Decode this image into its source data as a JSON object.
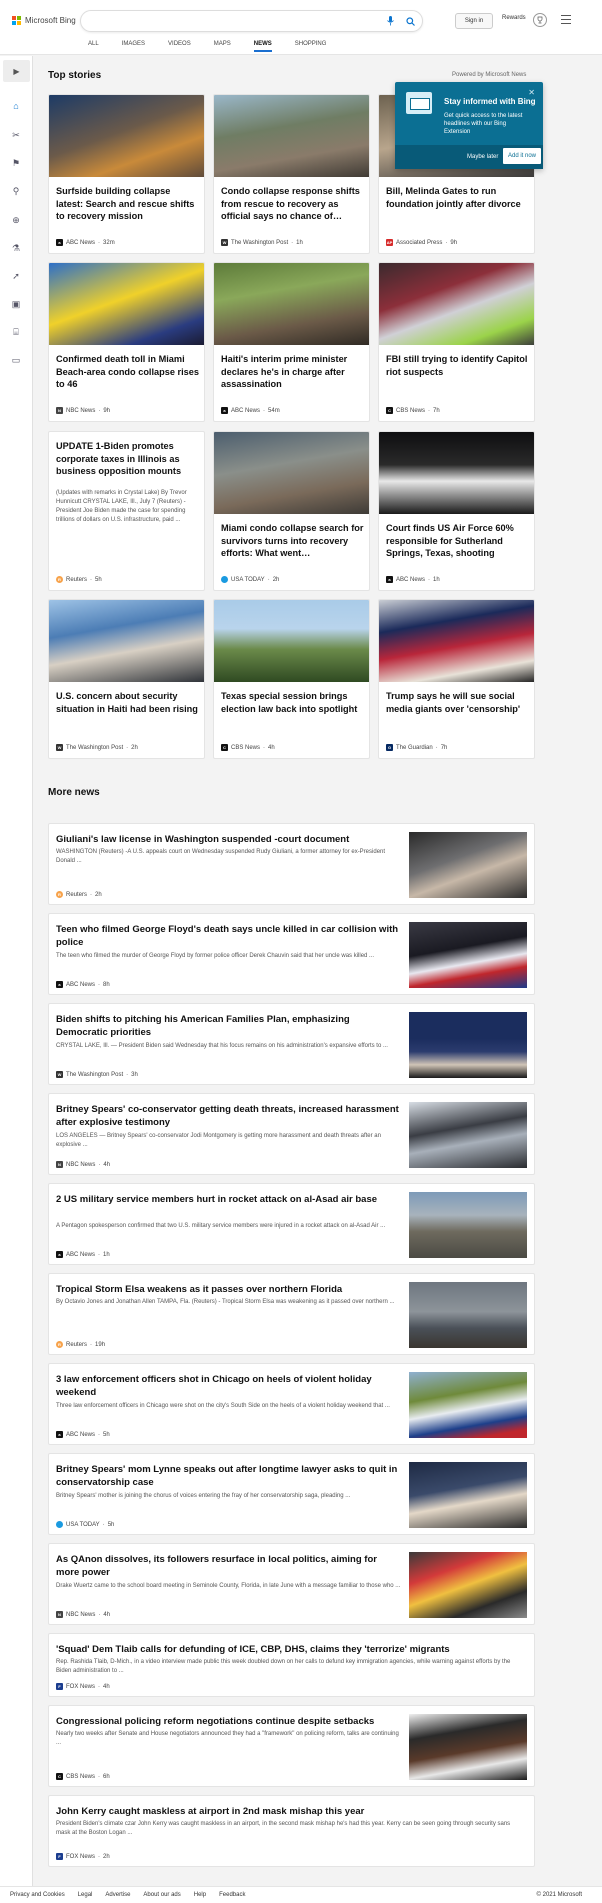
{
  "header": {
    "logo_text": "Microsoft Bing",
    "search_value": "",
    "signin_label": "Sign in",
    "rewards_label": "Rewards",
    "rewards_count": "1"
  },
  "nav": {
    "tabs": [
      {
        "label": "ALL"
      },
      {
        "label": "IMAGES"
      },
      {
        "label": "VIDEOS"
      },
      {
        "label": "MAPS"
      },
      {
        "label": "NEWS",
        "active": true
      },
      {
        "label": "SHOPPING"
      }
    ]
  },
  "sidebar": {
    "icons": [
      "expand-icon",
      "home-icon",
      "tools-icon",
      "flag-icon",
      "location-icon",
      "globe-icon",
      "science-icon",
      "rocket-icon",
      "entertainment-icon",
      "government-icon",
      "money-icon"
    ]
  },
  "top_stories": {
    "title": "Top stories",
    "powered_by": "Powered by Microsoft News",
    "cards": [
      {
        "title": "Surfside building collapse latest: Search and rescue shifts to recovery mission",
        "source": "ABC News",
        "time": "32m"
      },
      {
        "title": "Condo collapse response shifts from rescue to recovery as official says no chance of…",
        "source": "The Washington Post",
        "time": "1h"
      },
      {
        "title": "Bill, Melinda Gates to run foundation jointly after divorce",
        "source": "Associated Press",
        "time": "9h"
      },
      {
        "title": "Confirmed death toll in Miami Beach-area condo collapse rises to 46",
        "source": "NBC News",
        "time": "9h"
      },
      {
        "title": "Haiti's interim prime minister declares he's in charge after assassination",
        "source": "ABC News",
        "time": "54m"
      },
      {
        "title": "FBI still trying to identify Capitol riot suspects",
        "source": "CBS News",
        "time": "7h"
      },
      {
        "title": "UPDATE 1-Biden promotes corporate taxes in Illinois as business opposition mounts",
        "snippet": "(Updates with remarks in Crystal Lake) By Trevor Hunnicutt CRYSTAL LAKE, Ill., July 7 (Reuters) - President Joe Biden made the case for spending trillions of dollars on U.S. infrastructure, paid ...",
        "source": "Reuters",
        "time": "5h"
      },
      {
        "title": "Miami condo collapse search for survivors turns into recovery efforts: What went…",
        "source": "USA TODAY",
        "time": "2h"
      },
      {
        "title": "Court finds US Air Force 60% responsible for Sutherland Springs, Texas, shooting",
        "source": "ABC News",
        "time": "1h"
      },
      {
        "title": "U.S. concern about security situation in Haiti had been rising",
        "source": "The Washington Post",
        "time": "2h"
      },
      {
        "title": "Texas special session brings election law back into spotlight",
        "source": "CBS News",
        "time": "4h"
      },
      {
        "title": "Trump says he will sue social media giants over 'censorship'",
        "source": "The Guardian",
        "time": "7h"
      }
    ]
  },
  "promo": {
    "title": "Stay informed with Bing",
    "body": "Get quick access to the latest headlines with our Bing Extension",
    "later_label": "Maybe later",
    "add_label": "Add it now"
  },
  "more_news": {
    "title": "More news",
    "items": [
      {
        "title": "Giuliani's law license in Washington suspended -court document",
        "snippet": "WASHINGTON (Reuters) -A U.S. appeals court on Wednesday suspended Rudy Giuliani, a former attorney for ex-President Donald ...",
        "source": "Reuters",
        "time": "2h"
      },
      {
        "title": "Teen who filmed George Floyd's death says uncle killed in car collision with police",
        "snippet": "The teen who filmed the murder of George Floyd by former police officer Derek Chauvin said that her uncle was killed ...",
        "source": "ABC News",
        "time": "8h"
      },
      {
        "title": "Biden shifts to pitching his American Families Plan, emphasizing Democratic priorities",
        "snippet": "CRYSTAL LAKE, Ill. — President Biden said Wednesday that his focus remains on his administration's expansive efforts to ...",
        "source": "The Washington Post",
        "time": "3h"
      },
      {
        "title": "Britney Spears' co-conservator getting death threats, increased harassment after explosive testimony",
        "snippet": "LOS ANGELES — Britney Spears' co-conservator Jodi Montgomery is getting more harassment and death threats after an explosive ...",
        "source": "NBC News",
        "time": "4h"
      },
      {
        "title": "2 US military service members hurt in rocket attack on al-Asad air base",
        "snippet": "A Pentagon spokesperson confirmed that two U.S. military service members were injured in a rocket attack on al-Asad Air ...",
        "source": "ABC News",
        "time": "1h"
      },
      {
        "title": "Tropical Storm Elsa weakens as it passes over northern Florida",
        "snippet": "By Octavio Jones and Jonathan Allen TAMPA, Fla. (Reuters) - Tropical Storm Elsa was weakening as it passed over northern ...",
        "source": "Reuters",
        "time": "19h"
      },
      {
        "title": "3 law enforcement officers shot in Chicago on heels of violent holiday weekend",
        "snippet": "Three law enforcement officers in Chicago were shot on the city's South Side on the heels of a violent holiday weekend that ...",
        "source": "ABC News",
        "time": "5h"
      },
      {
        "title": "Britney Spears' mom Lynne speaks out after longtime lawyer asks to quit in conservatorship case",
        "snippet": "Britney Spears' mother is joining the chorus of voices entering the fray of her conservatorship saga, pleading ...",
        "source": "USA TODAY",
        "time": "5h"
      },
      {
        "title": "As QAnon dissolves, its followers resurface in local politics, aiming for more power",
        "snippet": "Drake Wuertz came to the school board meeting in Seminole County, Florida, in late June with a message familiar to those who ...",
        "source": "NBC News",
        "time": "4h"
      },
      {
        "title": "'Squad' Dem Tlaib calls for defunding of ICE, CBP, DHS, claims they 'terrorize' migrants",
        "snippet": "Rep. Rashida Tlaib, D-Mich., in a video interview made public this week doubled down on her calls to defund key immigration agencies, while warning against efforts by the Biden administration to ...",
        "source": "FOX News",
        "time": "4h"
      },
      {
        "title": "Congressional policing reform negotiations continue despite setbacks",
        "snippet": "Nearly two weeks after Senate and House negotiators announced they had a \"framework\" on policing reform, talks are continuing ...",
        "source": "CBS News",
        "time": "6h"
      },
      {
        "title": "John Kerry caught maskless at airport in 2nd mask mishap this year",
        "snippet": "President Biden's climate czar John Kerry was caught maskless in an airport, in the second mask mishap he's had this year. Kerry can be seen going through security sans mask at the Boston Logan ...",
        "source": "FOX News",
        "time": "2h"
      }
    ]
  },
  "footer": {
    "links": [
      "Privacy and Cookies",
      "Legal",
      "Advertise",
      "About our ads",
      "Help",
      "Feedback"
    ],
    "copyright": "© 2021 Microsoft"
  },
  "colors": {
    "accent": "#1a6fd0",
    "promo": "#0b6f93"
  }
}
